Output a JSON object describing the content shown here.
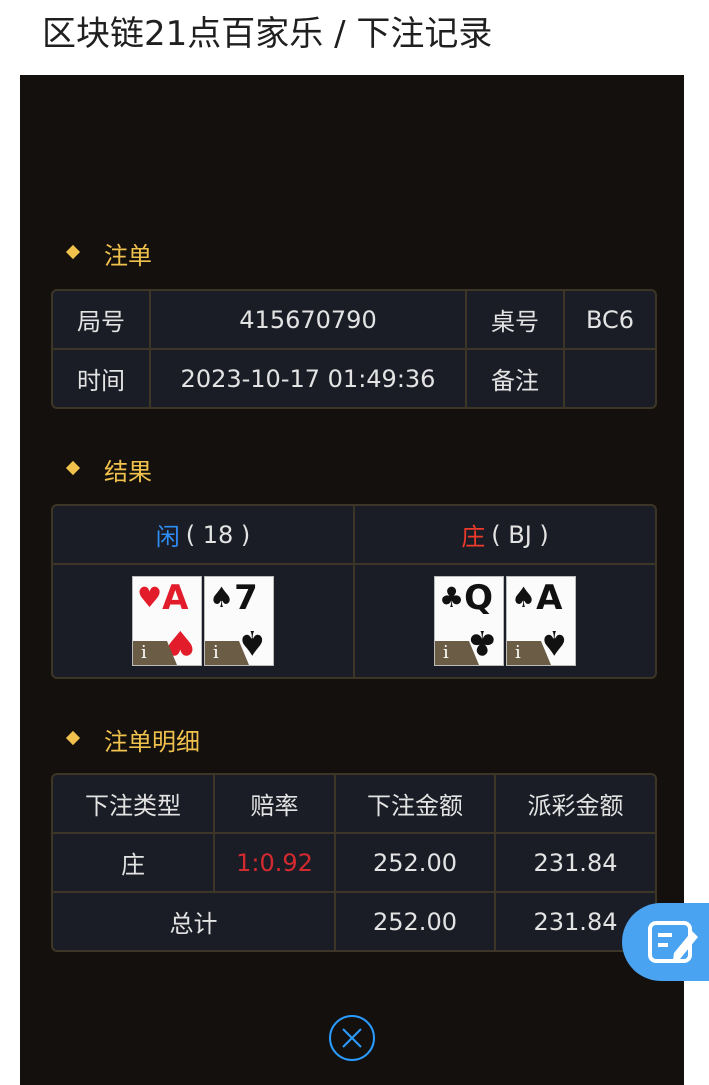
{
  "page_title": "区块链21点百家乐 / 下注记录",
  "order_section": {
    "heading": "注单",
    "round_label": "局号",
    "round_value": "415670790",
    "table_label": "桌号",
    "table_value": "BC6",
    "time_label": "时间",
    "time_value": "2023-10-17 01:49:36",
    "remark_label": "备注",
    "remark_value": ""
  },
  "result_section": {
    "heading": "结果",
    "player_label": "闲",
    "player_score": "( 18 )",
    "banker_label": "庄",
    "banker_score": "( BJ )",
    "player_cards": [
      {
        "rank": "A",
        "suit": "♥",
        "color": "red",
        "info": "i"
      },
      {
        "rank": "7",
        "suit": "♠",
        "color": "black",
        "info": "i"
      }
    ],
    "banker_cards": [
      {
        "rank": "Q",
        "suit": "♣",
        "color": "black",
        "info": "i"
      },
      {
        "rank": "A",
        "suit": "♠",
        "color": "black",
        "info": "i"
      }
    ]
  },
  "detail_section": {
    "heading": "注单明细",
    "columns": [
      "下注类型",
      "赔率",
      "下注金额",
      "派彩金额"
    ],
    "rows": [
      {
        "type": "庄",
        "odds": "1:0.92",
        "bet": "252.00",
        "payout": "231.84"
      }
    ],
    "total": {
      "label": "总计",
      "bet": "252.00",
      "payout": "231.84"
    }
  },
  "icons": {
    "close": "close-circle-icon",
    "edit": "edit-note-icon"
  },
  "colors": {
    "panel_bg": "#14100d",
    "accent_gold": "#f0c24d",
    "player_blue": "#2e8ef5",
    "banker_red": "#ee3a2a",
    "fab_blue": "#4aa3f0"
  }
}
